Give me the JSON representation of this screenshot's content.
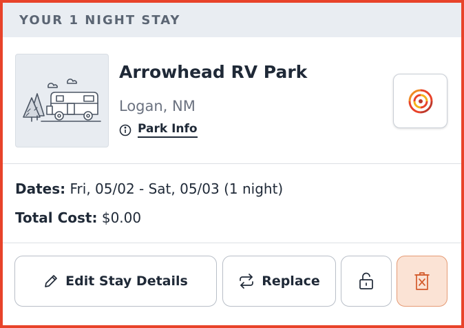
{
  "header": {
    "title": "YOUR 1 NIGHT STAY"
  },
  "park": {
    "name": "Arrowhead RV Park",
    "location": "Logan, NM",
    "info_label": "Park Info",
    "thumbnail_icon": "rv-park-illustration-icon",
    "locate_icon": "target-icon"
  },
  "stay": {
    "dates_label": "Dates:",
    "dates_value": "Fri, 05/02 - Sat, 05/03 (1 night)",
    "cost_label": "Total Cost:",
    "cost_value": "$0.00"
  },
  "actions": {
    "edit_label": "Edit Stay Details",
    "replace_label": "Replace",
    "unlock_icon": "unlock-icon",
    "delete_icon": "trash-icon"
  },
  "colors": {
    "border_accent": "#e8432a",
    "header_bg": "#e9edf2",
    "delete_bg": "#fbe3d5",
    "delete_icon": "#d35a2a"
  }
}
